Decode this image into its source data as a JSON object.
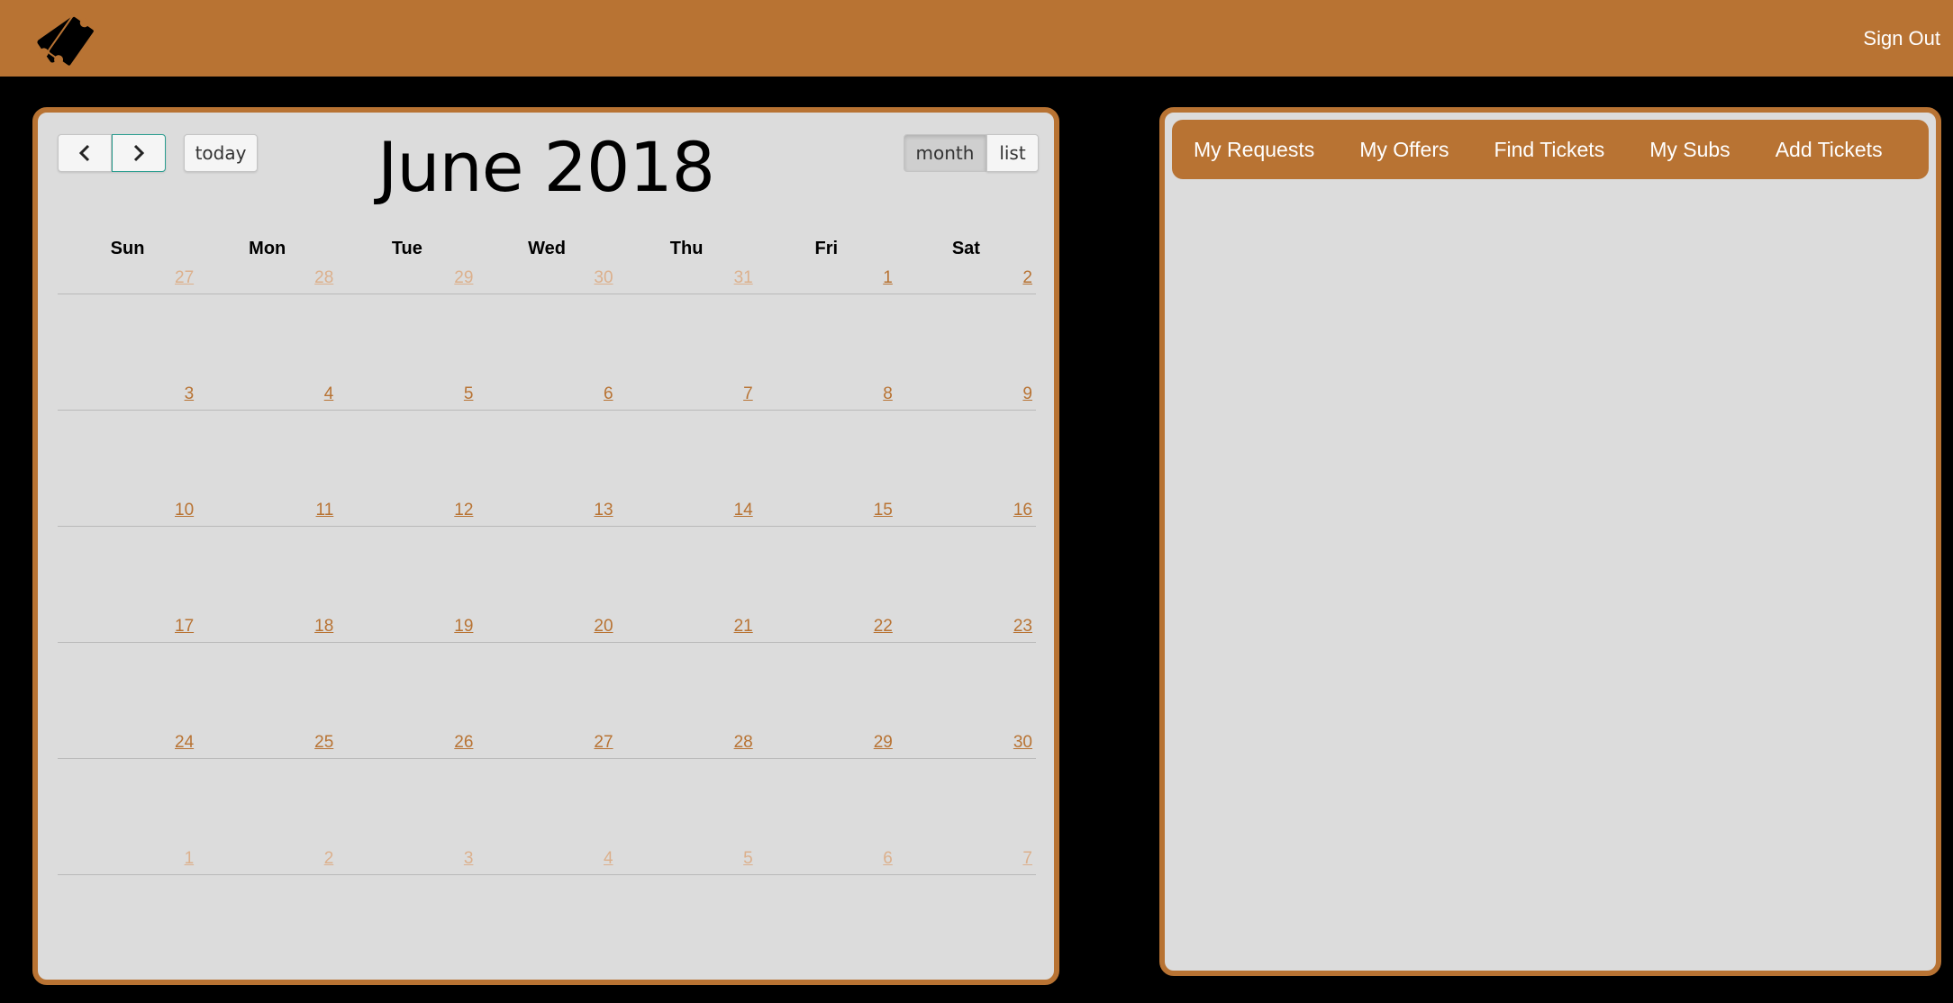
{
  "header": {
    "logo_icon": "tickets-icon",
    "sign_out_label": "Sign Out",
    "accent_color": "#b87333"
  },
  "calendar": {
    "title": "June 2018",
    "prev_icon": "chevron-left-icon",
    "next_icon": "chevron-right-icon",
    "today_label": "today",
    "view_month_label": "month",
    "view_list_label": "list",
    "active_view": "month",
    "weekdays": [
      "Sun",
      "Mon",
      "Tue",
      "Wed",
      "Thu",
      "Fri",
      "Sat"
    ],
    "weeks": [
      [
        {
          "d": "27",
          "other": true
        },
        {
          "d": "28",
          "other": true
        },
        {
          "d": "29",
          "other": true
        },
        {
          "d": "30",
          "other": true
        },
        {
          "d": "31",
          "other": true
        },
        {
          "d": "1",
          "other": false
        },
        {
          "d": "2",
          "other": false
        }
      ],
      [
        {
          "d": "3",
          "other": false
        },
        {
          "d": "4",
          "other": false
        },
        {
          "d": "5",
          "other": false
        },
        {
          "d": "6",
          "other": false
        },
        {
          "d": "7",
          "other": false
        },
        {
          "d": "8",
          "other": false
        },
        {
          "d": "9",
          "other": false
        }
      ],
      [
        {
          "d": "10",
          "other": false
        },
        {
          "d": "11",
          "other": false
        },
        {
          "d": "12",
          "other": false
        },
        {
          "d": "13",
          "other": false
        },
        {
          "d": "14",
          "other": false
        },
        {
          "d": "15",
          "other": false
        },
        {
          "d": "16",
          "other": false
        }
      ],
      [
        {
          "d": "17",
          "other": false
        },
        {
          "d": "18",
          "other": false
        },
        {
          "d": "19",
          "other": false
        },
        {
          "d": "20",
          "other": false
        },
        {
          "d": "21",
          "other": false
        },
        {
          "d": "22",
          "other": false
        },
        {
          "d": "23",
          "other": false
        }
      ],
      [
        {
          "d": "24",
          "other": false
        },
        {
          "d": "25",
          "other": false
        },
        {
          "d": "26",
          "other": false
        },
        {
          "d": "27",
          "other": false
        },
        {
          "d": "28",
          "other": false
        },
        {
          "d": "29",
          "other": false
        },
        {
          "d": "30",
          "other": false
        }
      ],
      [
        {
          "d": "1",
          "other": true
        },
        {
          "d": "2",
          "other": true
        },
        {
          "d": "3",
          "other": true
        },
        {
          "d": "4",
          "other": true
        },
        {
          "d": "5",
          "other": true
        },
        {
          "d": "6",
          "other": true
        },
        {
          "d": "7",
          "other": true
        }
      ]
    ]
  },
  "tabs": {
    "items": [
      "My Requests",
      "My Offers",
      "Find Tickets",
      "My Subs",
      "Add Tickets"
    ]
  }
}
